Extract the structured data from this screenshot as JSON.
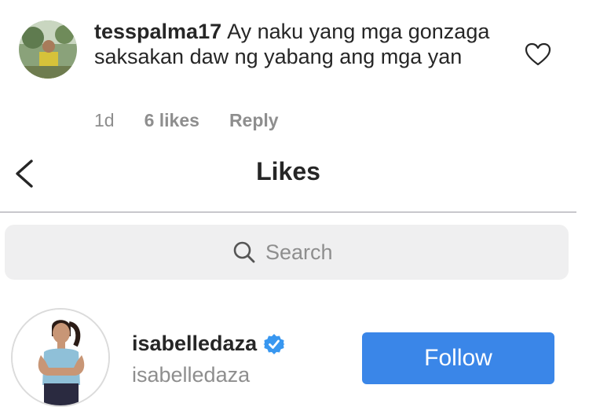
{
  "comment": {
    "username": "tesspalma17",
    "text": "Ay naku yang mga gonzaga saksakan daw ng yabang ang mga yan",
    "age": "1d",
    "likes": "6 likes",
    "reply_label": "Reply",
    "avatar_icon": "user-avatar-photo",
    "heart_icon": "heart-outline-icon"
  },
  "header": {
    "title": "Likes",
    "back_icon": "chevron-left-icon"
  },
  "search": {
    "placeholder": "Search",
    "icon": "search-icon"
  },
  "liker": {
    "username": "isabelledaza",
    "handle": "isabelledaza",
    "verified": true,
    "follow_label": "Follow",
    "colors": {
      "follow": "#3a86e8",
      "verified": "#3897f0"
    }
  }
}
